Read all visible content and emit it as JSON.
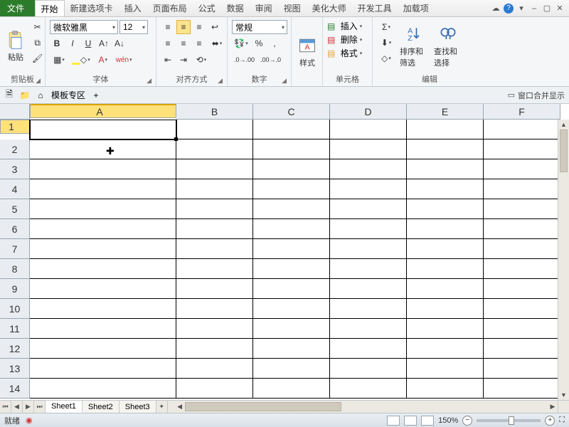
{
  "menu": {
    "file": "文件",
    "tabs": [
      "开始",
      "新建选项卡",
      "插入",
      "页面布局",
      "公式",
      "数据",
      "审阅",
      "视图",
      "美化大师",
      "开发工具",
      "加载项"
    ],
    "active_tab_index": 0
  },
  "ribbon": {
    "clipboard": {
      "label": "剪贴板",
      "paste": "粘贴"
    },
    "font": {
      "label": "字体",
      "name": "微软雅黑",
      "size": "12",
      "bold": "B",
      "italic": "I",
      "underline": "U"
    },
    "alignment": {
      "label": "对齐方式"
    },
    "number": {
      "label": "数字",
      "format": "常规",
      "percent": "%",
      "comma": ","
    },
    "styles": {
      "label": "样式"
    },
    "cells": {
      "label": "单元格",
      "insert": "插入",
      "delete": "删除",
      "format": "格式"
    },
    "editing": {
      "label": "编辑",
      "sort": "排序和筛选",
      "find": "查找和选择"
    }
  },
  "docbar": {
    "template_area": "模板专区",
    "merge_display": "窗口合并显示"
  },
  "grid": {
    "columns": [
      "A",
      "B",
      "C",
      "D",
      "E",
      "F"
    ],
    "rows": [
      "1",
      "2",
      "3",
      "4",
      "5",
      "6",
      "7",
      "8",
      "9",
      "10",
      "11",
      "12",
      "13",
      "14"
    ],
    "active_cell": "A1"
  },
  "tabs": {
    "sheets": [
      "Sheet1",
      "Sheet2",
      "Sheet3"
    ],
    "active_index": 0
  },
  "status": {
    "ready": "就绪",
    "zoom": "150%"
  }
}
